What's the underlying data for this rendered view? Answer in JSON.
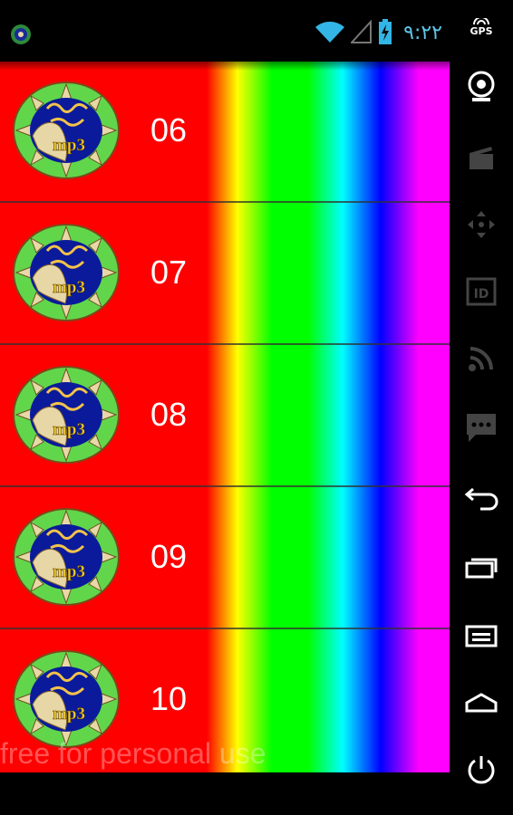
{
  "status_bar": {
    "time": "٩:٢٢",
    "icons": [
      "app-notification-icon",
      "wifi-icon",
      "signal-icon",
      "battery-charging-icon"
    ]
  },
  "side_nav": {
    "gps_label": "GPS",
    "icons": [
      "camera-icon",
      "movie-clapper-icon",
      "dpad-icon",
      "id-card-icon",
      "rss-icon",
      "chat-icon",
      "back-icon",
      "recent-apps-icon",
      "menu-icon",
      "home-icon",
      "power-icon"
    ]
  },
  "list": {
    "items": [
      {
        "number": "06",
        "logo_caption": "mp3"
      },
      {
        "number": "07",
        "logo_caption": "mp3"
      },
      {
        "number": "08",
        "logo_caption": "mp3"
      },
      {
        "number": "09",
        "logo_caption": "mp3"
      },
      {
        "number": "10",
        "logo_caption": "mp3"
      }
    ]
  },
  "watermark": "free for personal use",
  "colors": {
    "item_background": "#ff0000",
    "time_text": "#5fc4e8",
    "logo_ring": "#62d64a",
    "logo_center": "#0a1a9a"
  }
}
